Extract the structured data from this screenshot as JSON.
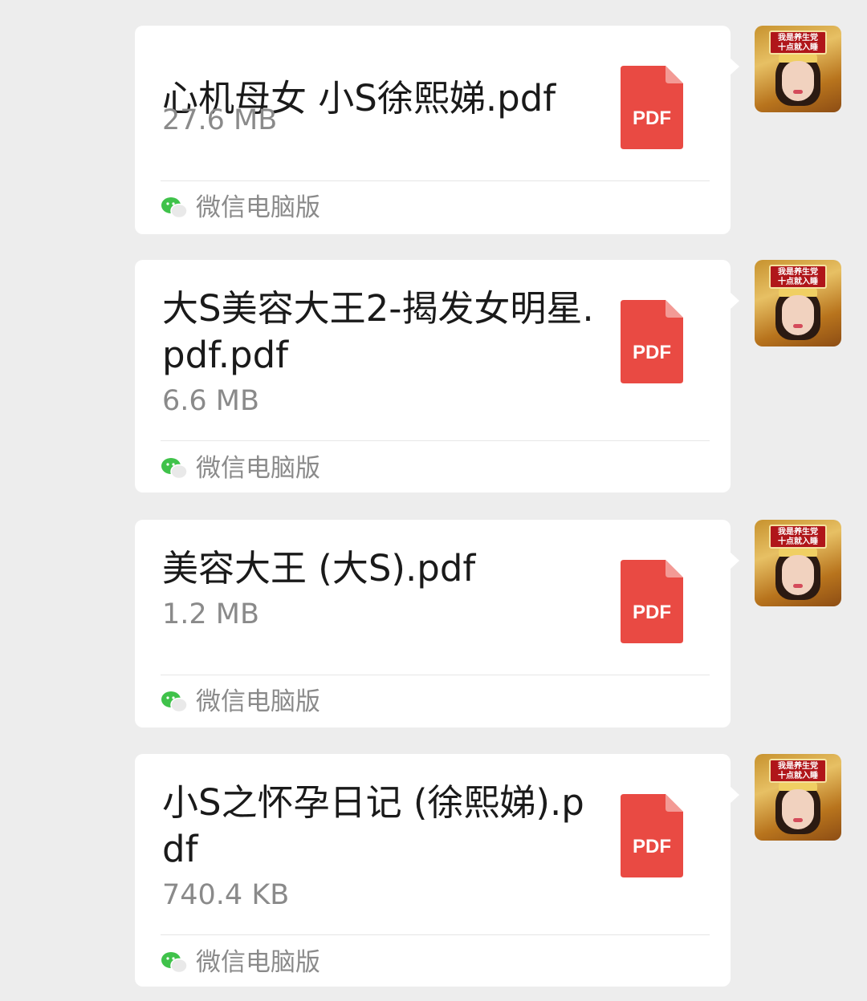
{
  "messages": [
    {
      "file_name": "心机母女 小S徐熙娣.pdf",
      "file_size": "27.6 MB",
      "file_type": "PDF",
      "source": "微信电脑版"
    },
    {
      "file_name": "大S美容大王2-揭发女明星.pdf.pdf",
      "file_size": "6.6 MB",
      "file_type": "PDF",
      "source": "微信电脑版"
    },
    {
      "file_name": "美容大王 (大S).pdf",
      "file_size": "1.2 MB",
      "file_type": "PDF",
      "source": "微信电脑版"
    },
    {
      "file_name": "小S之怀孕日记 (徐熙娣).pdf",
      "file_size": "740.4 KB",
      "file_type": "PDF",
      "source": "微信电脑版"
    }
  ],
  "avatar": {
    "banner_text_line1": "我是养生党",
    "banner_text_line2": "十点就入睡"
  },
  "colors": {
    "background": "#ededed",
    "bubble": "#ffffff",
    "pdf_red": "#e94a43",
    "wechat_green": "#3fc24a",
    "text_primary": "#1a1a1a",
    "text_secondary": "#8a8a8a"
  },
  "icons": {
    "file_icon": "pdf-file-icon",
    "source_icon": "wechat-icon"
  }
}
